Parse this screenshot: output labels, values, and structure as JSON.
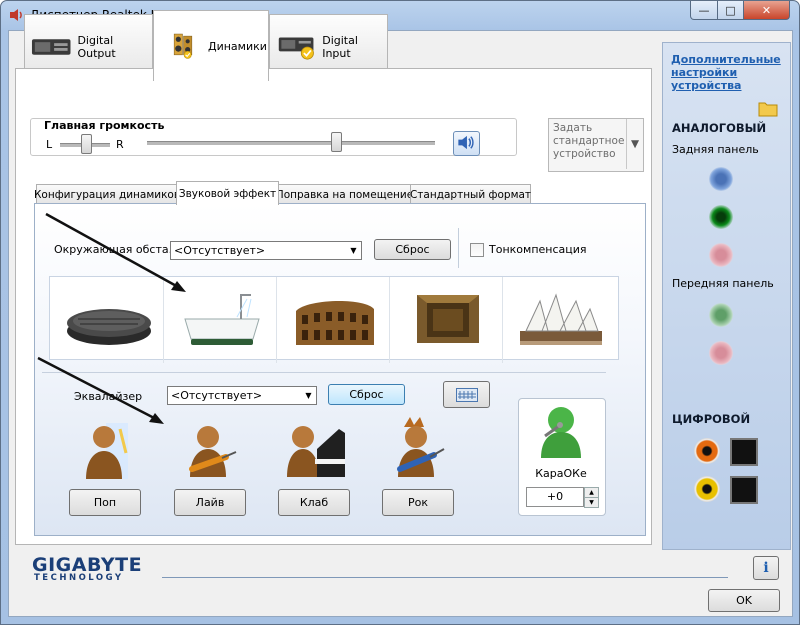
{
  "window": {
    "title": "Диспетчер Realtek HD",
    "minimize": "—",
    "maximize": "□",
    "close": "✕"
  },
  "device_tabs": [
    {
      "label": "Digital Output",
      "icon": "digital-output-device-icon"
    },
    {
      "label": "Динамики",
      "icon": "speakers-device-icon",
      "active": true
    },
    {
      "label": "Digital Input",
      "icon": "digital-input-device-icon"
    }
  ],
  "volume": {
    "label": "Главная громкость",
    "left": "L",
    "right": "R",
    "balance": 0.5,
    "level": 0.65
  },
  "default_device": {
    "label": "Задать стандартное устройство"
  },
  "sub_tabs": [
    {
      "label": "Конфигурация динамиков"
    },
    {
      "label": "Звуковой эффект",
      "active": true
    },
    {
      "label": "Поправка на помещение"
    },
    {
      "label": "Стандартный формат"
    }
  ],
  "environment": {
    "label": "Окружающая обста...",
    "value": "<Отсутствует>",
    "reset": "Сброс",
    "loudness": "Тонкомпенсация",
    "presets": [
      "sewer-pipe",
      "bathroom",
      "colosseum",
      "stone-room",
      "opera-house"
    ]
  },
  "equalizer": {
    "label": "Эквалайзер",
    "value": "<Отсутствует>",
    "reset": "Сброс",
    "presets": [
      {
        "label": "Поп"
      },
      {
        "label": "Лайв"
      },
      {
        "label": "Клаб"
      },
      {
        "label": "Рок"
      }
    ]
  },
  "karaoke": {
    "label": "КараОКе",
    "value": "+0"
  },
  "side": {
    "advanced_link": "Дополнительные настройки устройства",
    "analog_header": "АНАЛОГОВЫЙ",
    "rear_panel": "Задняя панель",
    "front_panel": "Передняя панель",
    "digital_header": "ЦИФРОВОЙ"
  },
  "colors": {
    "accent": "#1f5fb0",
    "jack_blue": "#5b86c7",
    "jack_green": "#0b8a1a",
    "jack_pink": "#e6a2ad",
    "coax_orange": "#e46a10",
    "coax_yellow": "#e8c000"
  },
  "footer": {
    "brand": "GIGABYTE",
    "brand_sub": "TECHNOLOGY",
    "ok": "OK"
  }
}
